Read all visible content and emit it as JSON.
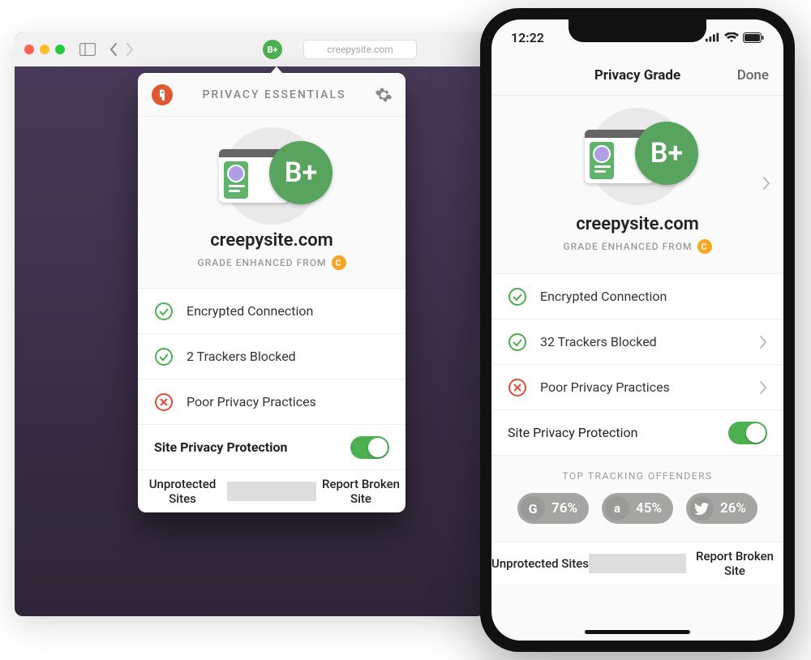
{
  "desktop": {
    "grade_pill": "B+",
    "url": "creepysite.com",
    "popup": {
      "title": "PRIVACY ESSENTIALS",
      "grade_badge": "B+",
      "site_name": "creepysite.com",
      "enhanced_prefix": "GRADE ENHANCED FROM",
      "enhanced_from": "C",
      "rows": {
        "encryption": {
          "text": "Encrypted Connection",
          "status": "ok"
        },
        "trackers": {
          "text": "2 Trackers Blocked",
          "status": "ok"
        },
        "practices": {
          "text": "Poor Privacy Practices",
          "status": "bad"
        }
      },
      "toggle_label": "Site Privacy Protection",
      "toggle_on": true,
      "footer": {
        "unprotected": "Unprotected Sites",
        "report": "Report Broken Site"
      }
    }
  },
  "phone": {
    "time": "12:22",
    "nav": {
      "title": "Privacy Grade",
      "done": "Done"
    },
    "grade_badge": "B+",
    "site_name": "creepysite.com",
    "enhanced_prefix": "GRADE ENHANCED FROM",
    "enhanced_from": "C",
    "rows": {
      "encryption": {
        "text": "Encrypted Connection",
        "status": "ok"
      },
      "trackers": {
        "text": "32 Trackers Blocked",
        "status": "ok"
      },
      "practices": {
        "text": "Poor Privacy Practices",
        "status": "bad"
      }
    },
    "toggle_label": "Site Privacy Protection",
    "offenders_title": "TOP TRACKING OFFENDERS",
    "offenders": [
      {
        "icon": "G",
        "pct": "76%"
      },
      {
        "icon": "a",
        "pct": "45%"
      },
      {
        "icon": "twitter",
        "pct": "26%"
      }
    ],
    "footer": {
      "unprotected": "Unprotected Sites",
      "report": "Report Broken Site"
    }
  }
}
